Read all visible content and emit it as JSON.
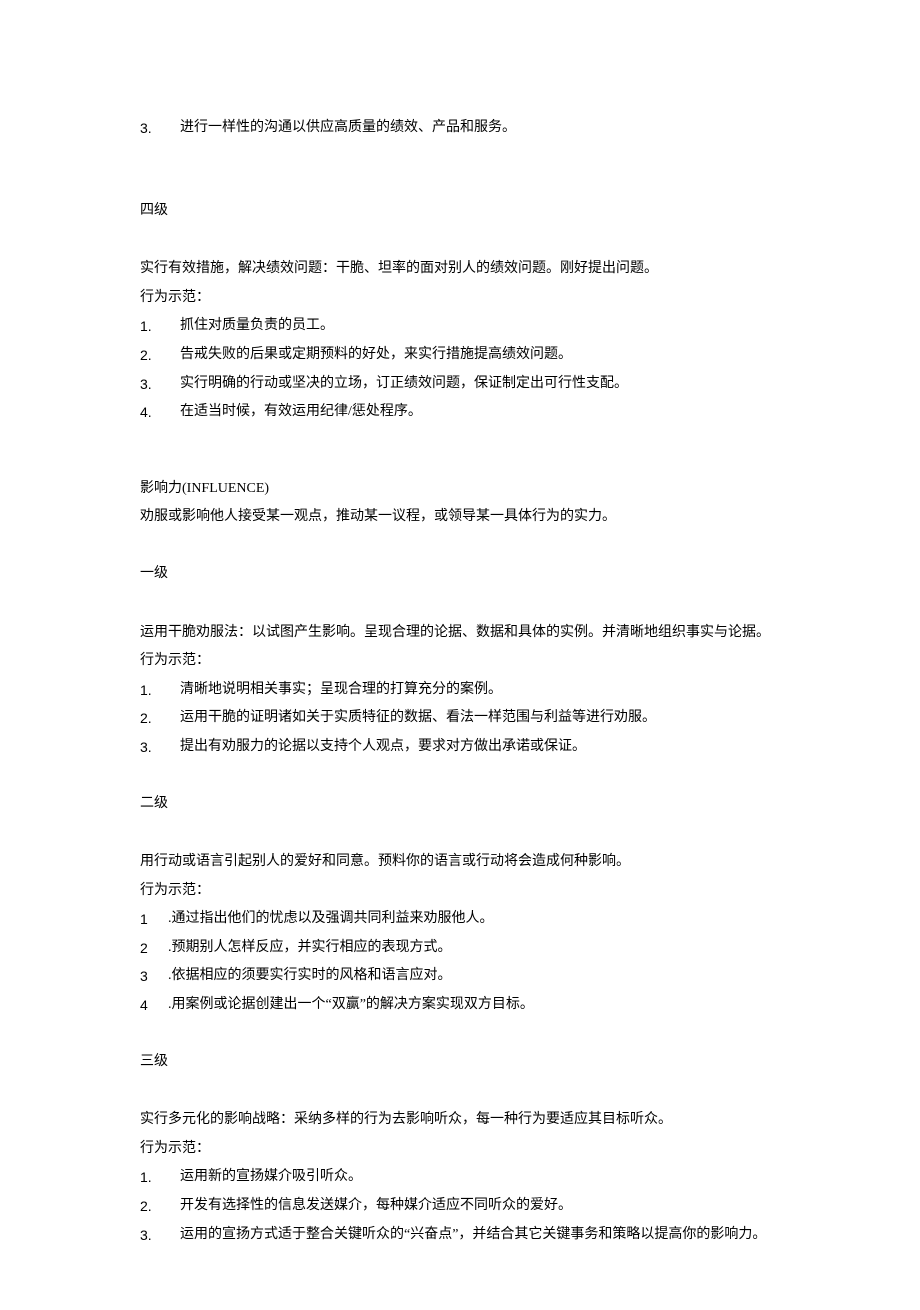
{
  "block0": {
    "list": [
      {
        "num": "3.",
        "text": "进行一样性的沟通以供应高质量的绩效、产品和服务。"
      }
    ]
  },
  "block1": {
    "level": "四级",
    "intro": "实行有效措施，解决绩效问题：干脆、坦率的面对别人的绩效问题。刚好提出问题。",
    "label": "行为示范：",
    "list": [
      {
        "num": "1.",
        "text": "抓住对质量负责的员工。"
      },
      {
        "num": "2.",
        "text": "告戒失败的后果或定期预料的好处，来实行措施提高绩效问题。"
      },
      {
        "num": "3.",
        "text": "实行明确的行动或坚决的立场，订正绩效问题，保证制定出可行性支配。"
      },
      {
        "num": "4.",
        "text": "在适当时候，有效运用纪律/惩处程序。"
      }
    ]
  },
  "block2": {
    "title": "影响力(INFLUENCE)",
    "desc": "劝服或影响他人接受某一观点，推动某一议程，或领导某一具体行为的实力。"
  },
  "block3": {
    "level": "一级",
    "intro": "运用干脆劝服法：以试图产生影响。呈现合理的论据、数据和具体的实例。并清晰地组织事实与论据。",
    "label": "行为示范：",
    "list": [
      {
        "num": "1.",
        "text": "清晰地说明相关事实；呈现合理的打算充分的案例。"
      },
      {
        "num": "2.",
        "text": "运用干脆的证明诸如关于实质特征的数据、看法一样范围与利益等进行劝服。"
      },
      {
        "num": "3.",
        "text": "提出有劝服力的论据以支持个人观点，要求对方做出承诺或保证。"
      }
    ]
  },
  "block4": {
    "level": "二级",
    "intro": "用行动或语言引起别人的爱好和同意。预料你的语言或行动将会造成何种影响。",
    "label": "行为示范：",
    "list": [
      {
        "num": "1",
        "text": ".通过指出他们的忧虑以及强调共同利益来劝服他人。"
      },
      {
        "num": "2",
        "text": ".预期别人怎样反应，并实行相应的表现方式。"
      },
      {
        "num": "3",
        "text": ".依据相应的须要实行实时的风格和语言应对。"
      },
      {
        "num": "4",
        "text": ".用案例或论据创建出一个“双赢”的解决方案实现双方目标。"
      }
    ]
  },
  "block5": {
    "level": "三级",
    "intro": "实行多元化的影响战略：采纳多样的行为去影响听众，每一种行为要适应其目标听众。",
    "label": "行为示范：",
    "list": [
      {
        "num": "1.",
        "text": "运用新的宣扬媒介吸引听众。"
      },
      {
        "num": "2.",
        "text": "开发有选择性的信息发送媒介，每种媒介适应不同听众的爱好。"
      },
      {
        "num": "3.",
        "text": "运用的宣扬方式适于整合关键听众的“兴奋点”，并结合其它关键事务和策略以提高你的影响力。"
      }
    ]
  }
}
